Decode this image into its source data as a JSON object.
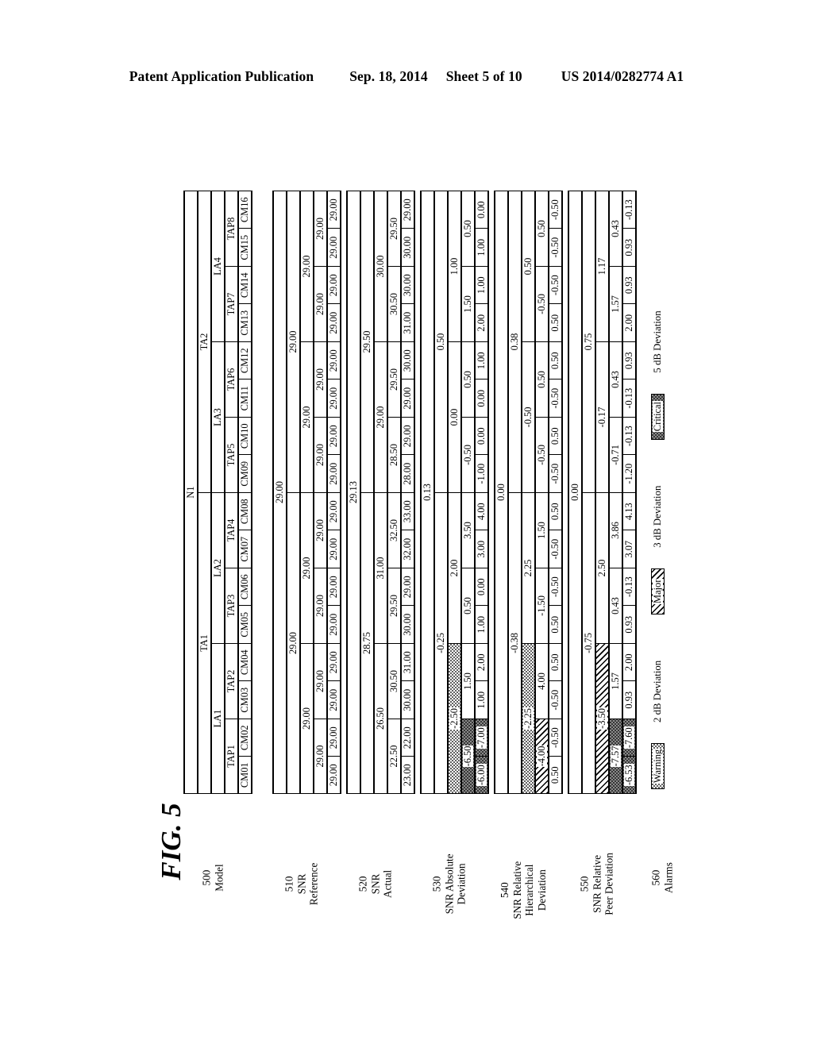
{
  "page_header": {
    "publication": "Patent Application Publication",
    "date": "Sep. 18, 2014",
    "sheet": "Sheet 5 of 10",
    "doc_number": "US 2014/0282774 A1"
  },
  "figure": {
    "label": "FIG. 5"
  },
  "model": {
    "network": "N1",
    "ta": [
      "TA1",
      "TA2"
    ],
    "la": [
      "LA1",
      "LA2",
      "LA3",
      "LA4"
    ],
    "tap": [
      "TAP1",
      "TAP2",
      "TAP3",
      "TAP4",
      "TAP5",
      "TAP6",
      "TAP7",
      "TAP8"
    ],
    "cm": [
      "CM01",
      "CM02",
      "CM03",
      "CM04",
      "CM05",
      "CM06",
      "CM07",
      "CM08",
      "CM09",
      "CM10",
      "CM11",
      "CM12",
      "CM13",
      "CM14",
      "CM15",
      "CM16"
    ]
  },
  "rows": [
    {
      "id": "500",
      "number": "500",
      "name": "Model",
      "kind": "model"
    },
    {
      "id": "510",
      "number": "510",
      "name": "SNR\nReference",
      "name_lines": [
        "SNR",
        "Reference"
      ],
      "network": "29.00",
      "ta": [
        "29.00",
        "29.00"
      ],
      "la": [
        "29.00",
        "29.00",
        "29.00",
        "29.00"
      ],
      "tap": [
        "29.00",
        "29.00",
        "29.00",
        "29.00",
        "29.00",
        "29.00",
        "29.00",
        "29.00"
      ],
      "cm": [
        "29.00",
        "29.00",
        "29.00",
        "29.00",
        "29.00",
        "29.00",
        "29.00",
        "29.00",
        "29.00",
        "29.00",
        "29.00",
        "29.00",
        "29.00",
        "29.00",
        "29.00",
        "29.00"
      ]
    },
    {
      "id": "520",
      "number": "520",
      "name_lines": [
        "SNR",
        "Actual"
      ],
      "network": "29.13",
      "ta": [
        "28.75",
        "29.50"
      ],
      "la": [
        "26.50",
        "31.00",
        "29.00",
        "30.00"
      ],
      "tap": [
        "22.50",
        "30.50",
        "29.50",
        "32.50",
        "28.50",
        "29.50",
        "30.50",
        "29.50"
      ],
      "cm": [
        "23.00",
        "22.00",
        "30.00",
        "31.00",
        "30.00",
        "29.00",
        "32.00",
        "33.00",
        "28.00",
        "29.00",
        "29.00",
        "30.00",
        "31.00",
        "30.00",
        "30.00",
        "29.00"
      ]
    },
    {
      "id": "530",
      "number": "530",
      "name_lines": [
        "SNR Absolute",
        "Deviation"
      ],
      "network": "0.13",
      "ta": [
        "-0.25",
        "0.50"
      ],
      "la": [
        "-2.50",
        "2.00",
        "0.00",
        "1.00"
      ],
      "tap": [
        "-6.50",
        "1.50",
        "0.50",
        "3.50",
        "-0.50",
        "0.50",
        "1.50",
        "0.50"
      ],
      "cm": [
        "-6.00",
        "-7.00",
        "1.00",
        "2.00",
        "1.00",
        "0.00",
        "3.00",
        "4.00",
        "-1.00",
        "0.00",
        "0.00",
        "1.00",
        "2.00",
        "1.00",
        "1.00",
        "0.00"
      ],
      "alarms": {
        "la": [
          "warning",
          null,
          null,
          null
        ],
        "tap": [
          "critical",
          null,
          null,
          null,
          null,
          null,
          null,
          null
        ],
        "cm": [
          "critical",
          "critical",
          null,
          null,
          null,
          null,
          null,
          null,
          null,
          null,
          null,
          null,
          null,
          null,
          null,
          null
        ]
      }
    },
    {
      "id": "540",
      "number": "540",
      "name_lines": [
        "SNR Relative",
        "Hierarchical",
        "Deviation"
      ],
      "network": "0.00",
      "ta": [
        "-0.38",
        "0.38"
      ],
      "la": [
        "-2.25",
        "2.25",
        "-0.50",
        "0.50"
      ],
      "tap": [
        "-4.00",
        "4.00",
        "-1.50",
        "1.50",
        "-0.50",
        "0.50",
        "-0.50",
        "0.50"
      ],
      "cm": [
        "0.50",
        "-0.50",
        "-0.50",
        "0.50",
        "0.50",
        "-0.50",
        "-0.50",
        "0.50",
        "-0.50",
        "0.50",
        "-0.50",
        "0.50",
        "0.50",
        "-0.50",
        "-0.50",
        "-0.50"
      ],
      "alarms": {
        "la": [
          "warning",
          null,
          null,
          null
        ],
        "tap": [
          "major",
          null,
          null,
          null,
          null,
          null,
          null,
          null
        ],
        "cm": [
          null,
          null,
          null,
          null,
          null,
          null,
          null,
          null,
          null,
          null,
          null,
          null,
          null,
          null,
          null,
          null
        ]
      }
    },
    {
      "id": "550",
      "number": "550",
      "name_lines": [
        "SNR Relative",
        "Peer Deviation"
      ],
      "network": "0.00",
      "ta": [
        "-0.75",
        "0.75"
      ],
      "la": [
        "-3.50",
        "2.50",
        "-0.17",
        "1.17"
      ],
      "tap": [
        "-7.57",
        "1.57",
        "0.43",
        "3.86",
        "-0.71",
        "0.43",
        "1.57",
        "0.43"
      ],
      "cm": [
        "-6.53",
        "-7.60",
        "0.93",
        "2.00",
        "0.93",
        "-0.13",
        "3.07",
        "4.13",
        "-1.20",
        "-0.13",
        "-0.13",
        "0.93",
        "2.00",
        "0.93",
        "0.93",
        "-0.13"
      ],
      "alarms": {
        "la": [
          "major",
          null,
          null,
          null
        ],
        "tap": [
          "critical",
          null,
          null,
          null,
          null,
          null,
          null,
          null
        ],
        "cm": [
          "critical",
          "critical",
          null,
          null,
          null,
          null,
          null,
          null,
          null,
          null,
          null,
          null,
          null,
          null,
          null,
          null
        ]
      }
    },
    {
      "id": "560",
      "number": "560",
      "name_lines": [
        "Alarms"
      ],
      "kind": "legend"
    }
  ],
  "legend": {
    "items": [
      {
        "swatch_label": "Warning",
        "pattern": "warning",
        "description": "2 dB Deviation"
      },
      {
        "swatch_label": "Major",
        "pattern": "major",
        "description": "3 dB Deviation"
      },
      {
        "swatch_label": "Critical",
        "pattern": "critical",
        "description": "5 dB Deviation"
      }
    ]
  }
}
